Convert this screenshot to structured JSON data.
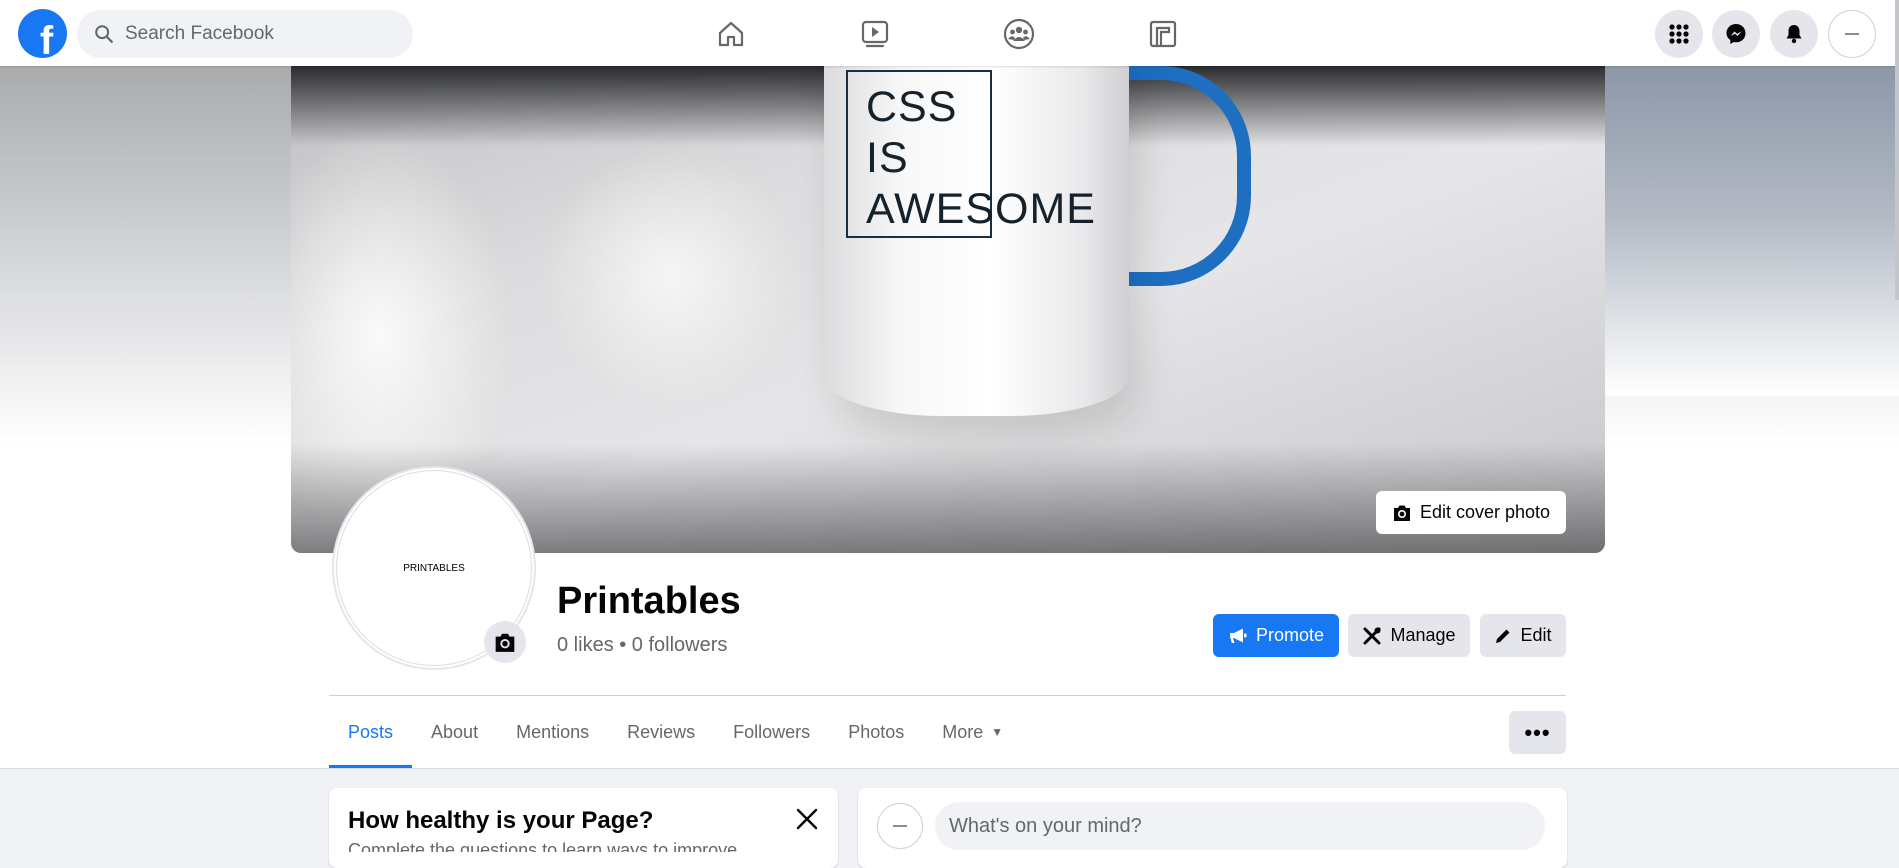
{
  "topnav": {
    "logo": "f",
    "search_placeholder": "Search Facebook",
    "icons": [
      "home-icon",
      "watch-icon",
      "groups-icon",
      "gaming-icon",
      "menu-grid-icon",
      "messenger-icon",
      "notifications-icon",
      "account-icon"
    ]
  },
  "cover": {
    "mug_text": [
      "CSS",
      "IS",
      "AWESOME"
    ],
    "edit_cover_label": "Edit cover photo"
  },
  "profile": {
    "picture_text": "PRINTABLES",
    "name": "Printables",
    "stats": "0 likes • 0 followers"
  },
  "actions": {
    "promote": "Promote",
    "manage": "Manage",
    "edit": "Edit"
  },
  "tabs": [
    {
      "label": "Posts",
      "active": true
    },
    {
      "label": "About"
    },
    {
      "label": "Mentions"
    },
    {
      "label": "Reviews"
    },
    {
      "label": "Followers"
    },
    {
      "label": "Photos"
    },
    {
      "label": "More"
    }
  ],
  "more_options": "•••",
  "health_card": {
    "title": "How healthy is your Page?",
    "subtitle": "Complete the questions to learn ways to improve"
  },
  "composer": {
    "placeholder": "What's on your mind?"
  },
  "colors": {
    "brand": "#1877f2",
    "button_gray": "#e4e6eb",
    "background": "#f0f2f5"
  }
}
